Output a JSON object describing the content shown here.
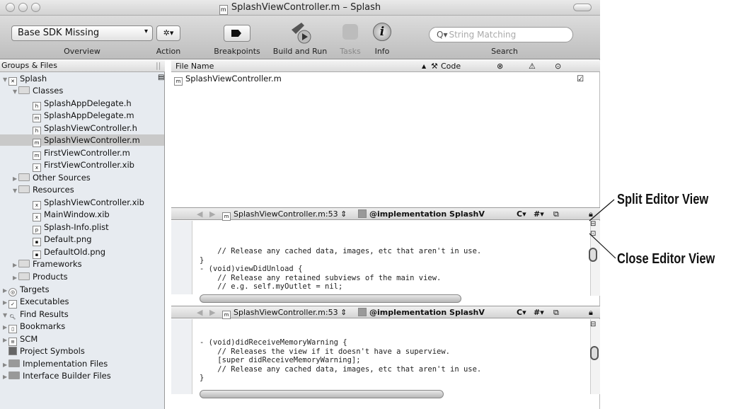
{
  "window": {
    "title": "SplashViewController.m – Splash"
  },
  "toolbar": {
    "sdk_select": "Base SDK Missing",
    "overview_label": "Overview",
    "action_label": "Action",
    "breakpoints_label": "Breakpoints",
    "build_run_label": "Build and Run",
    "tasks_label": "Tasks",
    "info_label": "Info",
    "search_placeholder": "String Matching",
    "search_label": "Search"
  },
  "sidebar": {
    "header": "Groups & Files",
    "items": [
      "Splash",
      "Classes",
      "SplashAppDelegate.h",
      "SplashAppDelegate.m",
      "SplashViewController.h",
      "SplashViewController.m",
      "FirstViewController.m",
      "FirstViewController.xib",
      "Other Sources",
      "Resources",
      "SplashViewController.xib",
      "MainWindow.xib",
      "Splash-Info.plist",
      "Default.png",
      "DefaultOld.png",
      "Frameworks",
      "Products",
      "Targets",
      "Executables",
      "Find Results",
      "Bookmarks",
      "SCM",
      "Project Symbols",
      "Implementation Files",
      "Interface Builder Files"
    ]
  },
  "filelist": {
    "col_filename": "File Name",
    "col_code": "Code",
    "rows": [
      "SplashViewController.m"
    ]
  },
  "editor1": {
    "file": "SplashViewController.m:53",
    "symbol": "@implementation SplashV",
    "lines": [
      "    // Release any cached data, images, etc that aren't in use.",
      "}",
      "",
      "- (void)viewDidUnload {",
      "    // Release any retained subviews of the main view.",
      "    // e.g. self.myOutlet = nil;"
    ]
  },
  "editor2": {
    "file": "SplashViewController.m:53",
    "symbol": "@implementation SplashV",
    "lines": [
      "- (void)didReceiveMemoryWarning {",
      "    // Releases the view if it doesn't have a superview.",
      "    [super didReceiveMemoryWarning];",
      "",
      "    // Release any cached data, images, etc that aren't in use.",
      "}"
    ]
  },
  "callouts": {
    "split": "Split Editor View",
    "close": "Close Editor View"
  }
}
